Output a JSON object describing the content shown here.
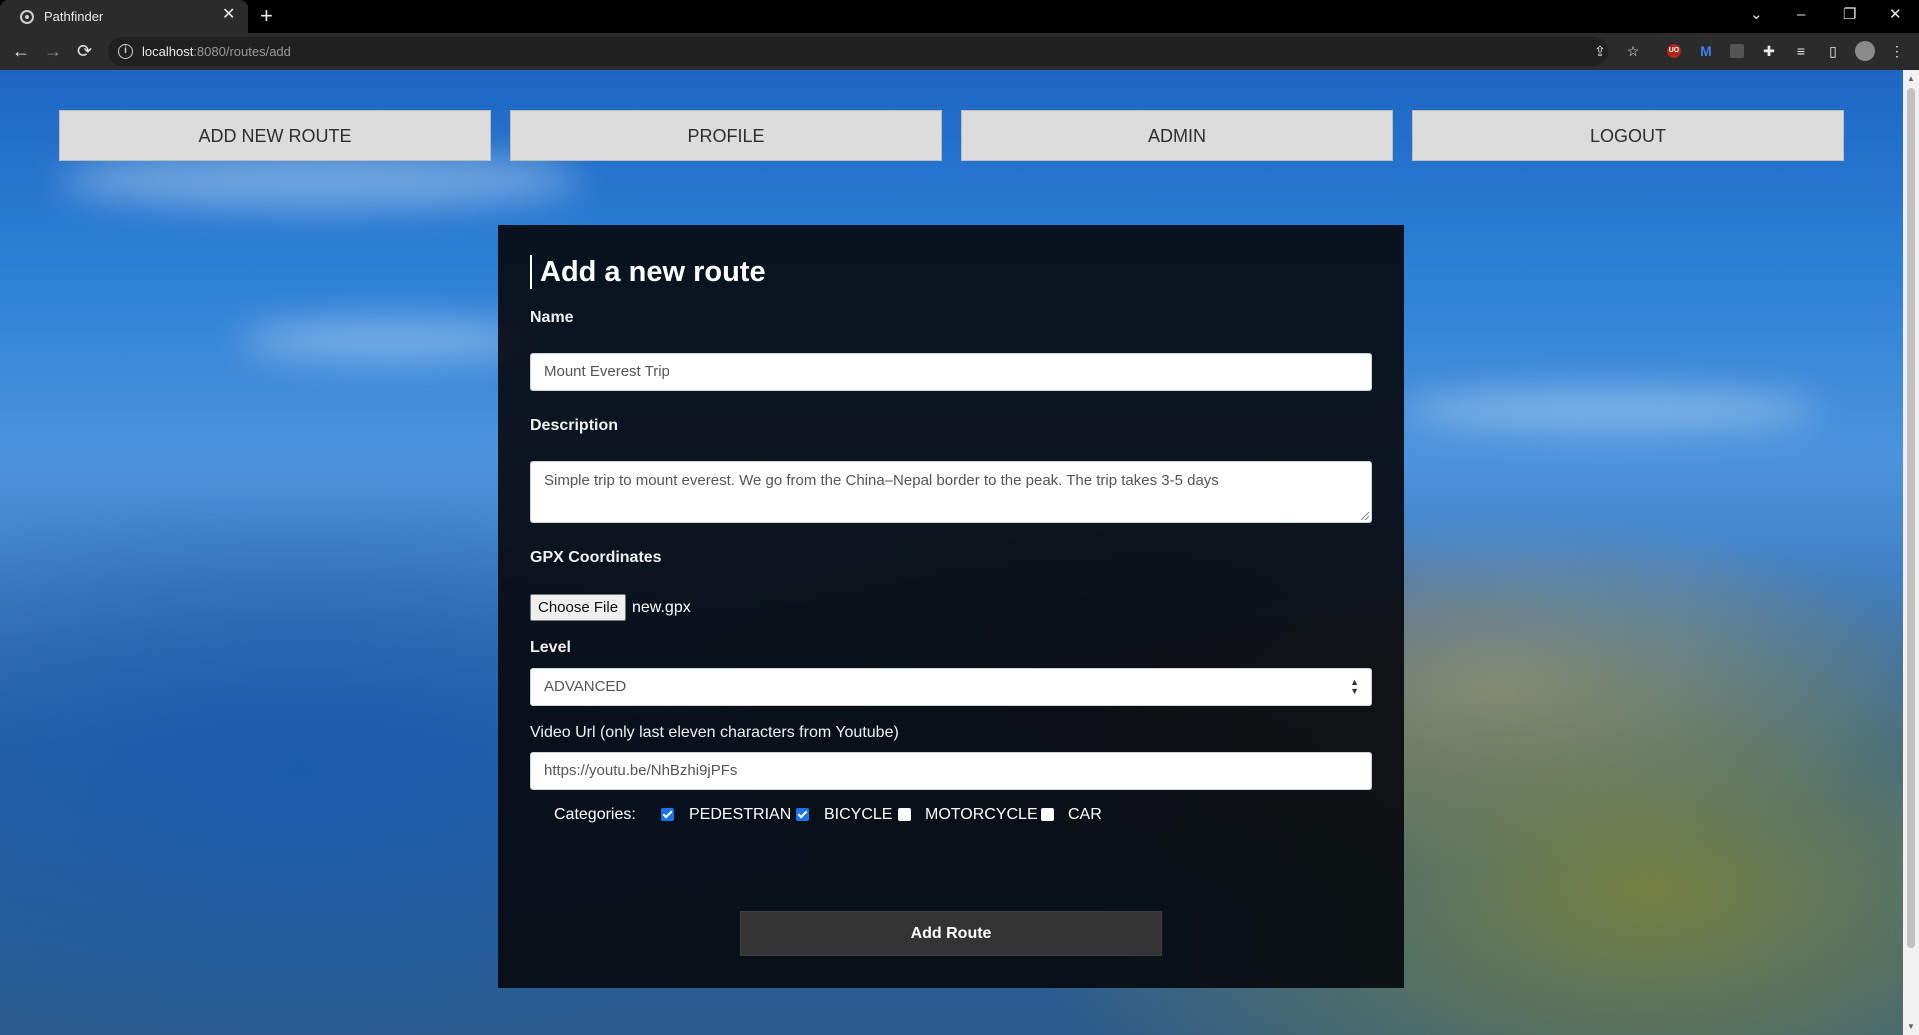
{
  "browser": {
    "tab_title": "Pathfinder",
    "tab_close": "✕",
    "new_tab": "+",
    "url_host": "localhost",
    "url_rest": ":8080/routes/add",
    "controls": {
      "dropdown": "⌄",
      "minimize": "–",
      "restore": "❐",
      "close": "✕"
    },
    "nav": {
      "back": "←",
      "forward": "→",
      "reload": "⟳"
    },
    "info": "i",
    "extension_red_label": "UO"
  },
  "nav": {
    "items": [
      "ADD NEW ROUTE",
      "PROFILE",
      "ADMIN",
      "LOGOUT"
    ]
  },
  "form": {
    "title": "Add a new route",
    "name_label": "Name",
    "name_value": "Mount Everest Trip",
    "description_label": "Description",
    "description_value": "Simple trip to mount everest. We go from the China–Nepal border to the peak. The trip takes 3-5 days",
    "gpx_label": "GPX Coordinates",
    "file_button": "Choose File",
    "file_name": "new.gpx",
    "level_label": "Level",
    "level_value": "ADVANCED",
    "video_label": "Video Url (only last eleven characters from Youtube)",
    "video_value": "https://youtu.be/NhBzhi9jPFs",
    "categories_label": "Categories:",
    "categories": [
      {
        "label": "PEDESTRIAN",
        "checked": true
      },
      {
        "label": "BICYCLE",
        "checked": true
      },
      {
        "label": "MOTORCYCLE",
        "checked": false
      },
      {
        "label": "CAR",
        "checked": false
      }
    ],
    "submit_label": "Add Route"
  },
  "colors": {
    "checkbox_checked": "#1a73e8",
    "card_bg": "#05080c",
    "nav_button_bg": "#dcdcdc"
  }
}
